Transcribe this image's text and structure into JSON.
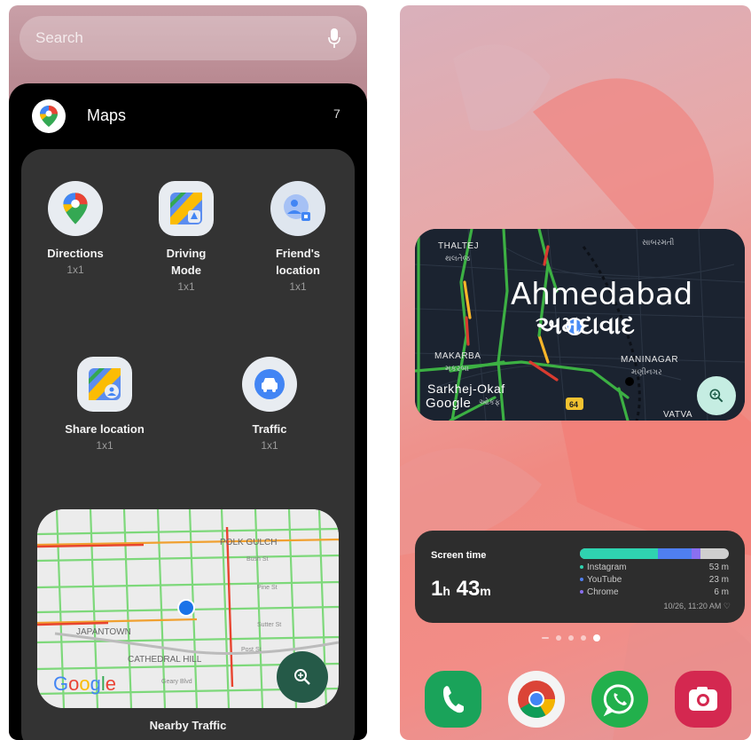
{
  "left": {
    "search": {
      "placeholder": "Search"
    },
    "app": {
      "name": "Maps",
      "count": "7"
    },
    "widgets": [
      {
        "label": "Directions",
        "size": "1x1",
        "icon": "google-maps-pin-icon"
      },
      {
        "label": "Driving Mode",
        "size": "1x1",
        "icon": "driving-mode-icon"
      },
      {
        "label": "Friend's location",
        "size": "1x1",
        "icon": "friends-location-icon"
      },
      {
        "label": "Share location",
        "size": "1x1",
        "icon": "share-location-icon"
      },
      {
        "label": "Traffic",
        "size": "1x1",
        "icon": "traffic-car-icon"
      }
    ],
    "nearby": {
      "title": "Nearby Traffic",
      "size": "4x2",
      "map_labels": [
        "POLK GULCH",
        "JAPANTOWN",
        "CATHEDRAL HILL",
        "Bush St",
        "Pine St",
        "Sutter St",
        "Post St",
        "Geary Blvd"
      ],
      "brand": "Google"
    }
  },
  "right": {
    "map": {
      "city_en": "Ahmedabad",
      "city_gu": "અમદાવાદ",
      "areas": [
        {
          "name": "THALTEJ",
          "sub": "થલતેજ"
        },
        {
          "name": "MAKARBA",
          "sub": "મકરબા"
        },
        {
          "name": "MANINAGAR",
          "sub": "મણીનગર"
        },
        {
          "name": "Sarkhej-Okaf",
          "sub": "ઓકફ"
        },
        {
          "name": "VATVA",
          "sub": ""
        },
        {
          "name": "",
          "sub": "સાબરમતી"
        }
      ],
      "highway": "64",
      "brand": "Google"
    },
    "screentime": {
      "title": "Screen time",
      "hours": "1",
      "hours_unit": "h",
      "minutes": "43",
      "minutes_unit": "m",
      "apps": [
        {
          "name": "Instagram",
          "value": "53 m",
          "color": "#2fd3b0"
        },
        {
          "name": "YouTube",
          "value": "23 m",
          "color": "#4f7ff0"
        },
        {
          "name": "Chrome",
          "value": "6 m",
          "color": "#8a6ff0"
        }
      ],
      "updated": "10/26, 11:20 AM"
    },
    "dock": [
      {
        "name": "Phone",
        "icon": "phone-icon",
        "color": "#1aa35a"
      },
      {
        "name": "Chrome",
        "icon": "chrome-icon",
        "color": "#f0f0f0"
      },
      {
        "name": "WhatsApp",
        "icon": "whatsapp-icon",
        "color": "#22b04c"
      },
      {
        "name": "Camera",
        "icon": "camera-icon",
        "color": "#d42850"
      }
    ]
  }
}
